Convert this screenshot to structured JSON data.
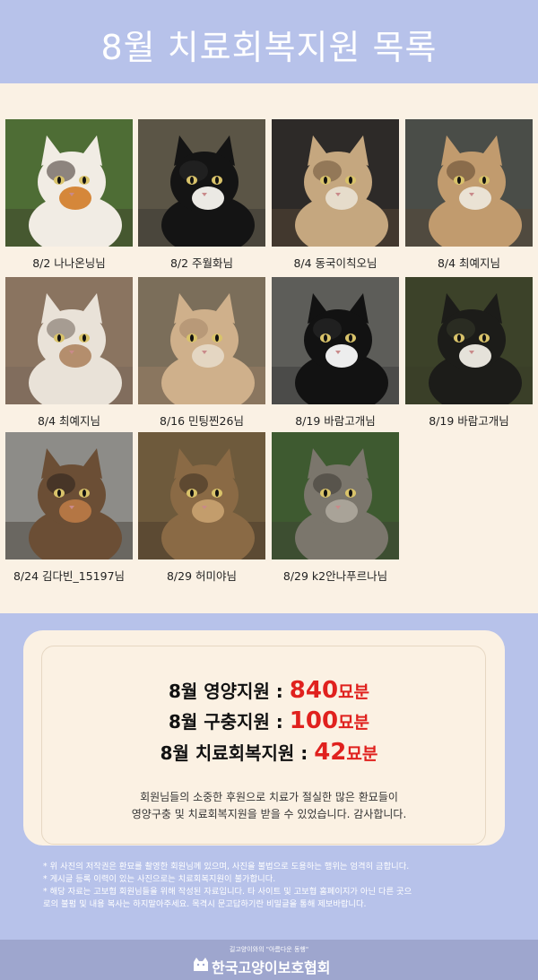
{
  "header": {
    "title": "8월 치료회복지원 목록"
  },
  "cats": [
    {
      "caption": "8/2 나나온닝님",
      "colors": {
        "bg": "#4e6d35",
        "body": "#f1ece4",
        "patch": "#d5873a",
        "patch2": "#3a3029"
      }
    },
    {
      "caption": "8/2 주월화님",
      "colors": {
        "bg": "#5b5546",
        "body": "#141414",
        "patch": "#ebe9e4",
        "patch2": "#2a2a2a"
      }
    },
    {
      "caption": "8/4 동국이칙오님",
      "colors": {
        "bg": "#2d2a28",
        "body": "#c5a77f",
        "patch": "#e6dccb",
        "patch2": "#6a5238"
      }
    },
    {
      "caption": "8/4 최예지님",
      "colors": {
        "bg": "#4a4d48",
        "body": "#c19b6e",
        "patch": "#eae2d4",
        "patch2": "#5c4530"
      }
    },
    {
      "caption": "8/4 최예지님",
      "colors": {
        "bg": "#8a7460",
        "body": "#e9e2d8",
        "patch": "#b48e6d",
        "patch2": "#6f6259"
      }
    },
    {
      "caption": "8/16 민팅찐26님",
      "colors": {
        "bg": "#7b6e5a",
        "body": "#cfb08b",
        "patch": "#e4d6c2",
        "patch2": "#a5866a"
      }
    },
    {
      "caption": "8/19 바람고개님",
      "colors": {
        "bg": "#5d5d59",
        "body": "#121212",
        "patch": "#ededed",
        "patch2": "#2b2b2b"
      }
    },
    {
      "caption": "8/19 바람고개님",
      "colors": {
        "bg": "#3c4229",
        "body": "#1c1c19",
        "patch": "#e5e2da",
        "patch2": "#363a29"
      }
    },
    {
      "caption": "8/24 김다빈_15197님",
      "colors": {
        "bg": "#8d8c88",
        "body": "#6b4e35",
        "patch": "#b47644",
        "patch2": "#2a211b"
      }
    },
    {
      "caption": "8/29 허미야님",
      "colors": {
        "bg": "#6e5a3c",
        "body": "#8a6a45",
        "patch": "#c39d6c",
        "patch2": "#3b2e21"
      }
    },
    {
      "caption": "8/29 k2안나푸르나님",
      "colors": {
        "bg": "#3e5a30",
        "body": "#7b766c",
        "patch": "#a9a398",
        "patch2": "#3c3833"
      }
    }
  ],
  "summary": {
    "nutrition_label": "8월 영양지원 : ",
    "nutrition_value": "840",
    "deworm_label": "8월 구충지원 : ",
    "deworm_value": "100",
    "recovery_label": "8월 치료회복지원 : ",
    "recovery_value": "42",
    "unit": "묘분",
    "thanks_line1": "회원님들의 소중한 후원으로 치료가 절실한 많은 환묘들이",
    "thanks_line2": "영양구충 및 치료회복지원을 받을 수 있었습니다. 감사합니다."
  },
  "notes": [
    "* 위 사진의 저작권은 환묘를 촬영한 회원님께 있으며, 사진을 불법으로 도용하는 행위는 엄격히 금합니다.",
    "* 게시글 등록 이력이 있는 사진으로는 치료회복지원이 불가합니다.",
    "* 해당 자료는 고보협 회원님들을 위해 작성된 자료입니다. 타 사이트 및 고보협 홈페이지가 아닌 다른 곳으",
    "  로의 불펌 및 내용 복사는 하지말아주세요.  목격시 문고답하기란 비밀글을 통해 제보바랍니다."
  ],
  "footer": {
    "slogan": "길고양이와의  \"아름다운 동행\"",
    "org_name": "한국고양이보호협회"
  }
}
